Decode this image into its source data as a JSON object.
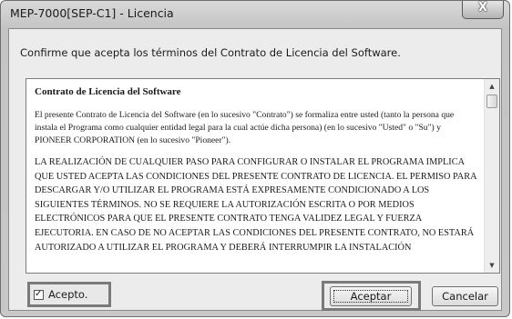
{
  "window": {
    "title": "MEP-7000[SEP-C1] - Licencia",
    "close_glyph": "X"
  },
  "dialog": {
    "prompt": "Confirme que acepta los términos del Contrato de Licencia del Software."
  },
  "license": {
    "title": "Contrato de Licencia del Software",
    "paragraph1": "El presente Contrato de Licencia del Software (en lo sucesivo \"Contrato\") se formaliza entre usted (tanto la persona que instala el Programa como cualquier entidad legal para la cual actúe dicha persona) (en lo sucesivo \"Usted\" o \"Su\") y PIONEER CORPORATION (en lo sucesivo \"Pioneer\").",
    "paragraph2": "LA REALIZACIÓN DE CUALQUIER PASO PARA CONFIGURAR O INSTALAR EL PROGRAMA IMPLICA QUE USTED ACEPTA LAS CONDICIONES DEL PRESENTE CONTRATO DE LICENCIA. EL PERMISO PARA DESCARGAR Y/O UTILIZAR EL PROGRAMA ESTÁ EXPRESAMENTE CONDICIONADO A LOS SIGUIENTES TÉRMINOS. NO SE REQUIERE LA AUTORIZACIÓN ESCRITA O POR MEDIOS ELECTRÓNICOS PARA QUE EL PRESENTE CONTRATO TENGA VALIDEZ LEGAL Y FUERZA EJECUTORIA. EN CASO DE NO ACEPTAR LAS CONDICIONES DEL PRESENTE CONTRATO, NO ESTARÁ AUTORIZADO A UTILIZAR EL PROGRAMA Y DEBERÁ INTERRUMPIR LA INSTALACIÓN"
  },
  "scrollbar": {
    "up_glyph": "▲",
    "down_glyph": "▼"
  },
  "accept_checkbox": {
    "checked": true,
    "check_glyph": "✓",
    "label": "Acepto."
  },
  "buttons": {
    "accept_label": "Aceptar",
    "cancel_label": "Cancelar"
  },
  "icons": {
    "close": "close-icon",
    "scroll_up": "scroll-up-arrow-icon",
    "scroll_down": "scroll-down-arrow-icon",
    "check": "checkmark-icon"
  }
}
